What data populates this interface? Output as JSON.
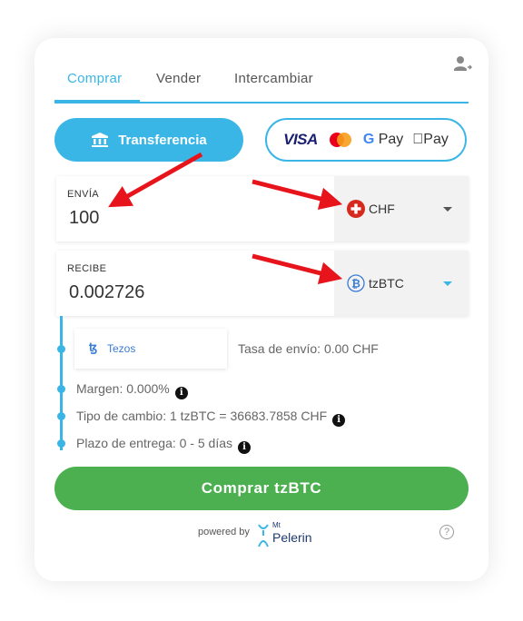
{
  "tabs": [
    {
      "label": "Comprar",
      "active": true
    },
    {
      "label": "Vender",
      "active": false
    },
    {
      "label": "Intercambiar",
      "active": false
    }
  ],
  "payment": {
    "transfer_label": "Transferencia",
    "visa_label": "VISA",
    "gpay_label": "Pay",
    "gpay_g": "G",
    "applepay_label": "Pay"
  },
  "send": {
    "label": "ENVÍA",
    "value": "100",
    "currency": "CHF"
  },
  "receive": {
    "label": "RECIBE",
    "value": "0.002726",
    "currency": "tzBTC"
  },
  "network": {
    "name": "Tezos"
  },
  "details": {
    "fee": "Tasa de envío: 0.00 CHF",
    "margin": "Margen: 0.000%",
    "rate": "Tipo de cambio: 1 tzBTC = 36683.7858 CHF",
    "delivery": "Plazo de entrega: 0 - 5 días"
  },
  "buy_button": "Comprar tzBTC",
  "footer": {
    "powered_by": "powered by",
    "brand_small": "Mt",
    "brand": "Pelerin",
    "help": "?"
  },
  "colors": {
    "accent": "#3ab6e6",
    "buy": "#4caf50",
    "annotation_arrow": "#e8141c"
  }
}
